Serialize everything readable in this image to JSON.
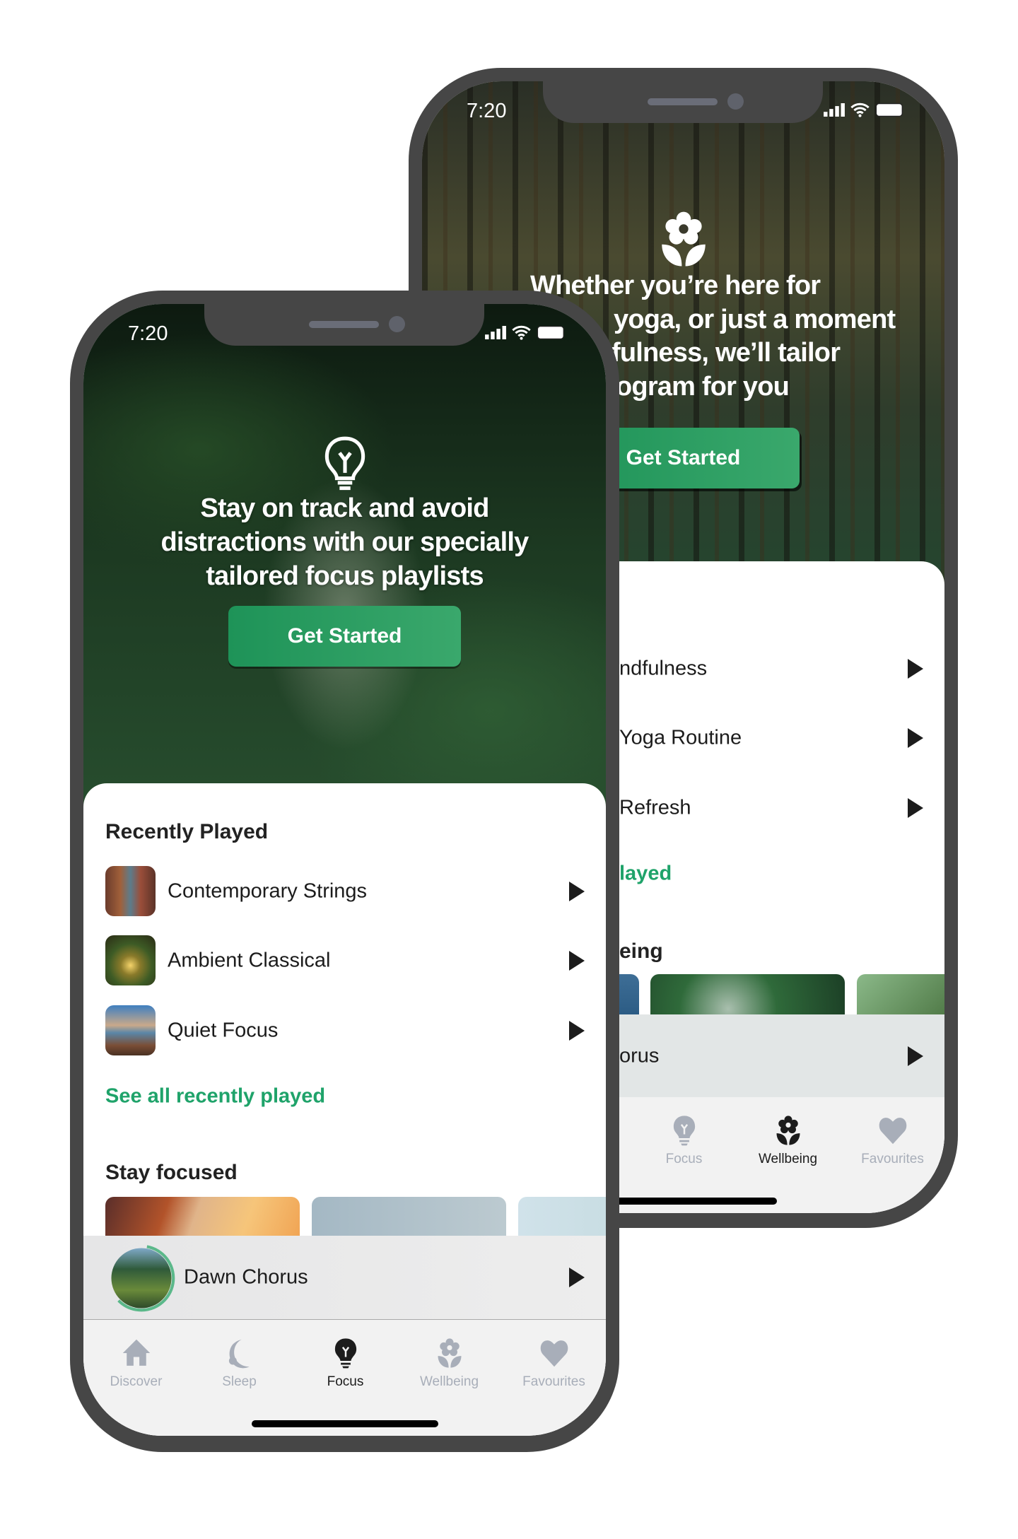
{
  "colors": {
    "accent": "#1fa36a",
    "button": "#2a9d62",
    "bezel": "#464646",
    "inactive_tab": "#a8aeb9"
  },
  "back_phone": {
    "status_time": "7:20",
    "hero_icon": "flower-icon",
    "headline_lines": [
      "Whether you’re here for",
      "yoga, or just a moment",
      "fulness, we’ll tailor",
      "ogram for you"
    ],
    "cta_label": "Get Started",
    "list_items": [
      {
        "title": "ndfulness"
      },
      {
        "title": "Yoga Routine"
      },
      {
        "title": "Refresh"
      }
    ],
    "link_text": "layed",
    "section_heading": "eing",
    "mini_player_title": "orus",
    "tabs": [
      {
        "label": "Focus",
        "icon": "lightbulb-icon",
        "active": false
      },
      {
        "label": "Wellbeing",
        "icon": "flower-icon",
        "active": true
      },
      {
        "label": "Favourites",
        "icon": "heart-icon",
        "active": false
      }
    ]
  },
  "front_phone": {
    "status_time": "7:20",
    "hero_icon": "lightbulb-icon",
    "headline_lines": [
      "Stay on track and avoid",
      "distractions with our specially",
      "tailored focus playlists"
    ],
    "cta_label": "Get Started",
    "recently_played": {
      "heading": "Recently Played",
      "items": [
        {
          "title": "Contemporary Strings"
        },
        {
          "title": "Ambient Classical"
        },
        {
          "title": "Quiet Focus"
        }
      ],
      "see_all": "See all recently played"
    },
    "stay_focused": {
      "heading": "Stay focused"
    },
    "mini_player": {
      "title": "Dawn Chorus",
      "progress": 0.6
    },
    "tabs": [
      {
        "label": "Discover",
        "icon": "home-icon",
        "active": false
      },
      {
        "label": "Sleep",
        "icon": "moon-icon",
        "active": false
      },
      {
        "label": "Focus",
        "icon": "lightbulb-icon",
        "active": true
      },
      {
        "label": "Wellbeing",
        "icon": "flower-icon",
        "active": false
      },
      {
        "label": "Favourites",
        "icon": "heart-icon",
        "active": false
      }
    ]
  }
}
